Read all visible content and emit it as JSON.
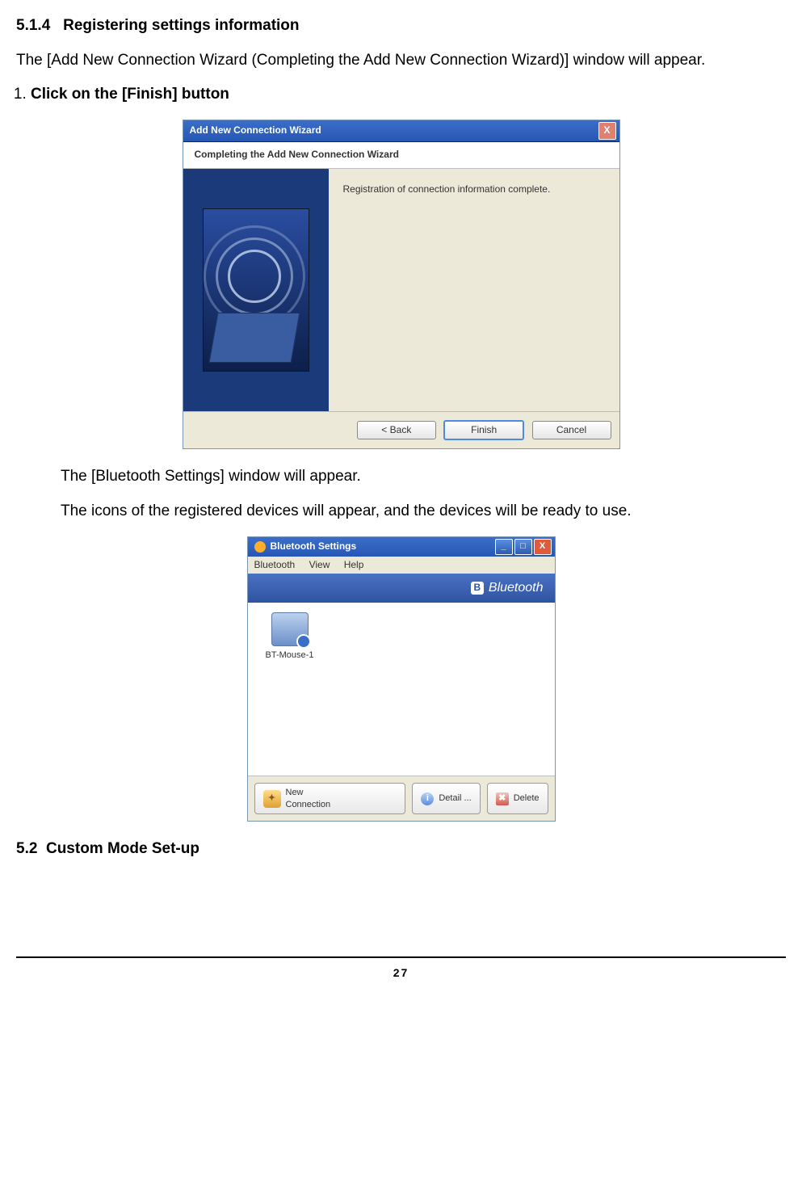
{
  "section": {
    "number": "5.1.4",
    "title": "Registering settings information"
  },
  "intro": "The [Add New Connection Wizard (Completing the Add New Connection Wizard)] window will appear.",
  "step1_num": "1.",
  "step1_text": "Click on the [Finish] button",
  "wizard": {
    "title": "Add New Connection Wizard",
    "subtitle": "Completing the Add New Connection Wizard",
    "body_text": "Registration of connection information complete.",
    "btn_back": "< Back",
    "btn_finish": "Finish",
    "btn_cancel": "Cancel",
    "close_glyph": "X"
  },
  "after_para1": "The [Bluetooth Settings] window will appear.",
  "after_para2": "The icons of the registered devices will appear, and the devices will be ready to use.",
  "bt": {
    "title": "Bluetooth Settings",
    "menu": {
      "m1": "Bluetooth",
      "m2": "View",
      "m3": "Help"
    },
    "brand": "Bluetooth",
    "brand_glyph": "B",
    "device_label": "BT-Mouse-1",
    "btn_new": "New",
    "btn_new_sub": "Connection",
    "btn_detail": "Detail ...",
    "btn_delete": "Delete",
    "min_glyph": "_",
    "max_glyph": "□",
    "close_glyph": "X",
    "info_glyph": "i",
    "del_glyph": "✖",
    "new_glyph": "✦"
  },
  "subsection": {
    "number": "5.2",
    "title": "Custom Mode Set-up"
  },
  "page_number": "27"
}
